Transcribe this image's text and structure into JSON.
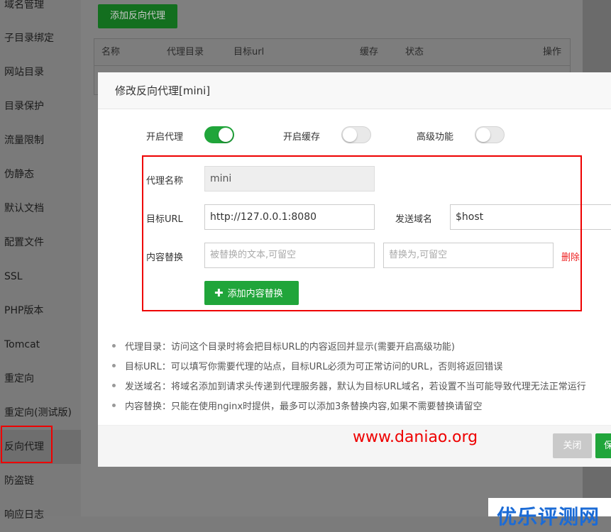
{
  "sidebar": {
    "items": [
      {
        "label": "域名管理"
      },
      {
        "label": "子目录绑定"
      },
      {
        "label": "网站目录"
      },
      {
        "label": "目录保护"
      },
      {
        "label": "流量限制"
      },
      {
        "label": "伪静态"
      },
      {
        "label": "默认文档"
      },
      {
        "label": "配置文件"
      },
      {
        "label": "SSL"
      },
      {
        "label": "PHP版本"
      },
      {
        "label": "Tomcat"
      },
      {
        "label": "重定向"
      },
      {
        "label": "重定向(测试版)"
      },
      {
        "label": "反向代理"
      },
      {
        "label": "防盗链"
      },
      {
        "label": "响应日志"
      }
    ],
    "active_index": 13
  },
  "main": {
    "add_button": "添加反向代理",
    "columns": [
      "名称",
      "代理目录",
      "目标url",
      "缓存",
      "状态",
      "操作"
    ]
  },
  "modal": {
    "title": "修改反向代理[mini]",
    "toggles": [
      {
        "label": "开启代理",
        "on": true
      },
      {
        "label": "开启缓存",
        "on": false
      },
      {
        "label": "高级功能",
        "on": false
      }
    ],
    "fields": {
      "name_label": "代理名称",
      "name_value": "mini",
      "url_label": "目标URL",
      "url_value": "http://127.0.0.1:8080",
      "send_domain_label": "发送域名",
      "send_domain_value": "$host",
      "replace_label": "内容替换",
      "replace_from_placeholder": "被替换的文本,可留空",
      "replace_to_placeholder": "替换为,可留空",
      "delete_label": "删除"
    },
    "add_replace_button": "添加内容替换",
    "tips": [
      "代理目录：访问这个目录时将会把目标URL的内容返回并显示(需要开启高级功能)",
      "目标URL：可以填写你需要代理的站点，目标URL必须为可正常访问的URL，否则将返回错误",
      "发送域名：将域名添加到请求头传递到代理服务器，默认为目标URL域名，若设置不当可能导致代理无法正常运行",
      "内容替换：只能在使用nginx时提供，最多可以添加3条替换内容,如果不需要替换请留空"
    ],
    "close_button": "关闭",
    "save_button": "保存"
  },
  "watermark": "www.daniao.org",
  "logo_text": "优乐评测网",
  "colors": {
    "accent_green": "#20a53a",
    "highlight_red": "#e00000"
  }
}
